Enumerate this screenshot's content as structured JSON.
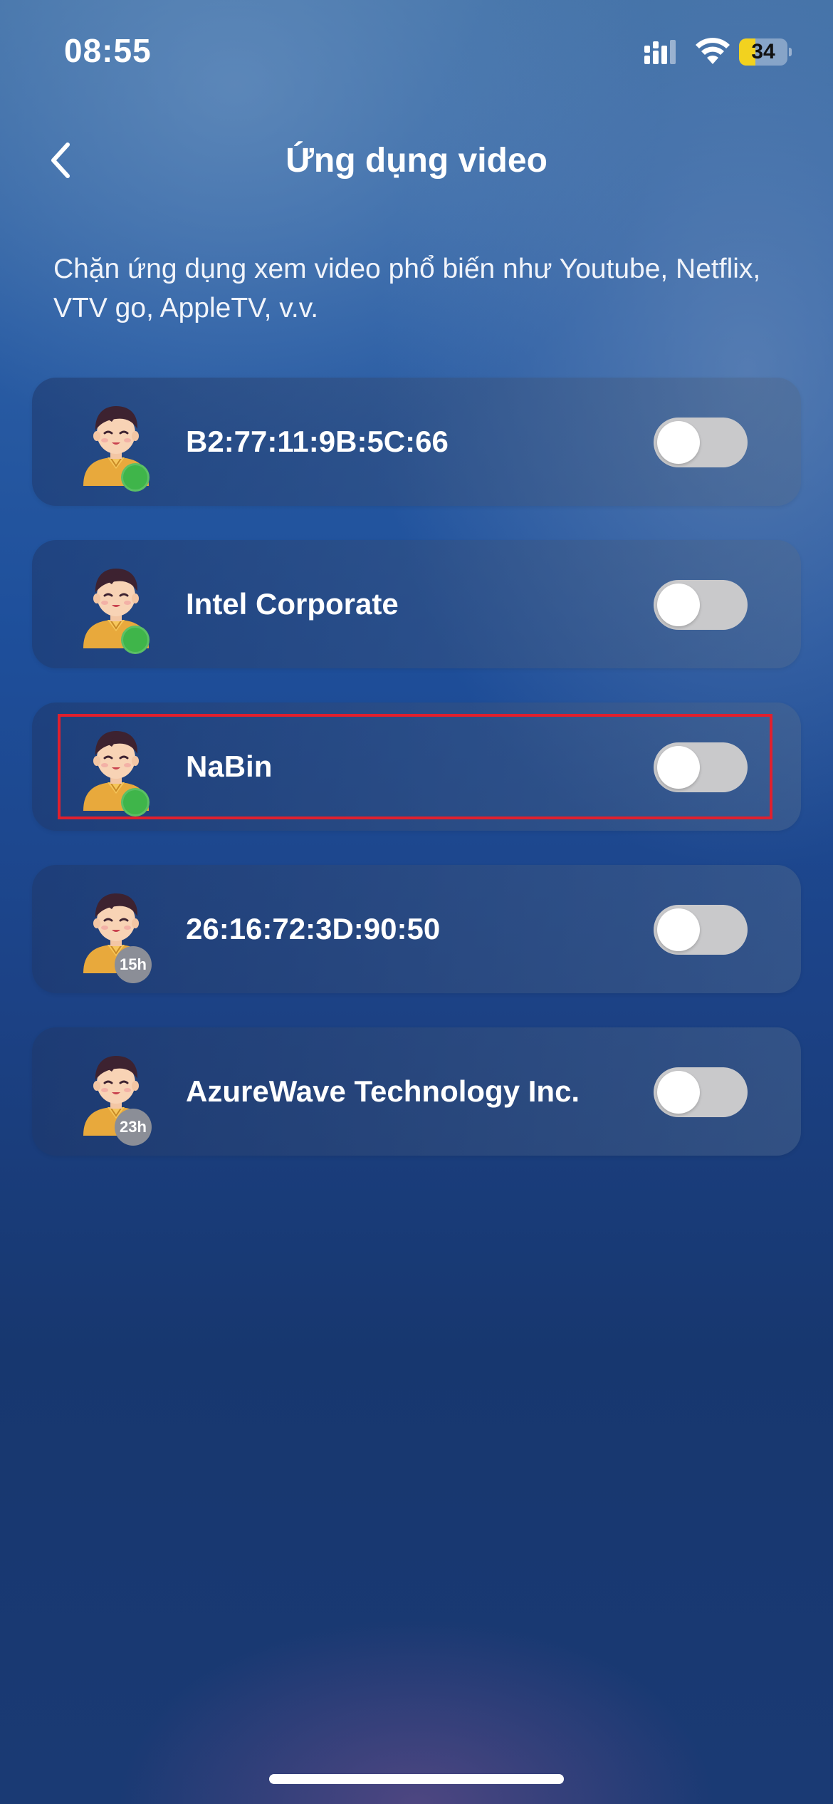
{
  "status_bar": {
    "time": "08:55",
    "battery_level": "34",
    "battery_percent": 34,
    "battery_color": "#f2d21f"
  },
  "header": {
    "title": "Ứng dụng video",
    "back_icon": "chevron-left-icon"
  },
  "description": "Chặn ứng dụng xem video phổ biến như Youtube, Netflix, VTV go, AppleTV, v.v.",
  "devices": [
    {
      "name": "B2:77:11:9B:5C:66",
      "status": "online",
      "toggle_on": false
    },
    {
      "name": "Intel Corporate",
      "status": "online",
      "toggle_on": false
    },
    {
      "name": "NaBin",
      "status": "online",
      "toggle_on": false,
      "highlighted": true
    },
    {
      "name": "26:16:72:3D:90:50",
      "status": "offline",
      "last_seen": "15h",
      "toggle_on": false
    },
    {
      "name": "AzureWave Technology Inc.",
      "status": "offline",
      "last_seen": "23h",
      "toggle_on": false
    }
  ],
  "colors": {
    "online_dot": "#3fb54a",
    "offline_badge": "#8b8e97",
    "toggle_off": "#c9c9cb",
    "highlight_border": "#e0202e"
  }
}
